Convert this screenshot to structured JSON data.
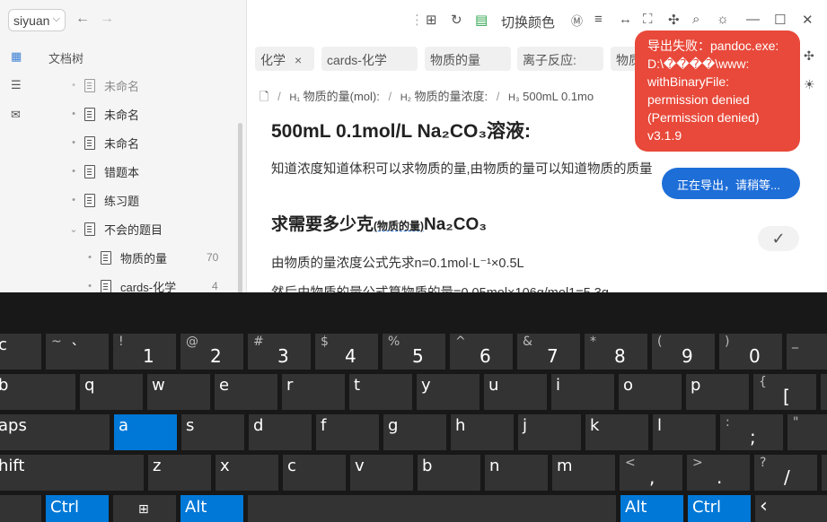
{
  "sidebar": {
    "workspace": "siyuan",
    "title": "文档树",
    "items": [
      {
        "label": "未命名",
        "count": ""
      },
      {
        "label": "未命名",
        "count": ""
      },
      {
        "label": "未命名",
        "count": ""
      },
      {
        "label": "错题本",
        "count": ""
      },
      {
        "label": "练习题",
        "count": ""
      },
      {
        "label": "不会的题目",
        "count": ""
      },
      {
        "label": "物质的量",
        "count": "70"
      },
      {
        "label": "cards-化学",
        "count": "4"
      }
    ]
  },
  "toolbar": {
    "switch_color": "切换颜色"
  },
  "tags": [
    {
      "label": "化学",
      "close": "×"
    },
    {
      "label": "cards-化学",
      "close": ""
    },
    {
      "label": "物质的量",
      "close": ""
    },
    {
      "label": "离子反应:",
      "close": ""
    },
    {
      "label": "物质",
      "close": ""
    }
  ],
  "breadcrumb": {
    "h1": "物质的量(mol):",
    "h2": "物质的量浓度:",
    "h3": "500mL 0.1mo"
  },
  "doc": {
    "heading": "500mL 0.1mol/L Na₂CO₃溶液:",
    "para1": "知道浓度知道体积可以求物质的量,由物质的量可以知道物质的质量",
    "h4_main": "求需要多少克",
    "h4_small": "(物质的量)",
    "h4_tail": "Na₂CO₃",
    "para2": "由物质的量浓度公式先求n=0.1mol·L⁻¹×0.5L",
    "para3": "然后由物质的量公式算物质的量=0.05mol×106g/mol1=5.3g"
  },
  "toasts": {
    "error_lines": [
      "导出失败：pandoc.exe:",
      "D:\\����\\www:",
      "withBinaryFile:",
      "permission denied",
      "(Permission denied)",
      "v3.1.9"
    ],
    "info": "正在导出，请稍等..."
  },
  "keyboard": {
    "row1": [
      {
        "top": "~",
        "main": "`",
        "label": "c"
      },
      {
        "top": "!",
        "main": "1"
      },
      {
        "top": "@",
        "main": "2"
      },
      {
        "top": "#",
        "main": "3"
      },
      {
        "top": "$",
        "main": "4"
      },
      {
        "top": "%",
        "main": "5"
      },
      {
        "top": "^",
        "main": "6"
      },
      {
        "top": "&",
        "main": "7"
      },
      {
        "top": "*",
        "main": "8"
      },
      {
        "top": "(",
        "main": "9"
      },
      {
        "top": ")",
        "main": "0"
      },
      {
        "top": "_",
        "main": ""
      }
    ],
    "row2": [
      "b",
      "q",
      "w",
      "e",
      "r",
      "t",
      "y",
      "u",
      "i",
      "o",
      "p",
      "["
    ],
    "row2_top_last": "{",
    "row3": [
      "aps",
      "a",
      "s",
      "d",
      "f",
      "g",
      "h",
      "j",
      "k",
      "l",
      ";",
      "'"
    ],
    "row3_top": [
      ":",
      "\""
    ],
    "row4": [
      "hift",
      "z",
      "x",
      "c",
      "v",
      "b",
      "n",
      "m",
      ",",
      ".",
      "/"
    ],
    "row4_top": [
      "<",
      ">",
      "?"
    ],
    "row5": {
      "ctrl": "Ctrl",
      "alt": "Alt",
      "alt2": "Alt",
      "ctrl2": "Ctrl"
    }
  }
}
